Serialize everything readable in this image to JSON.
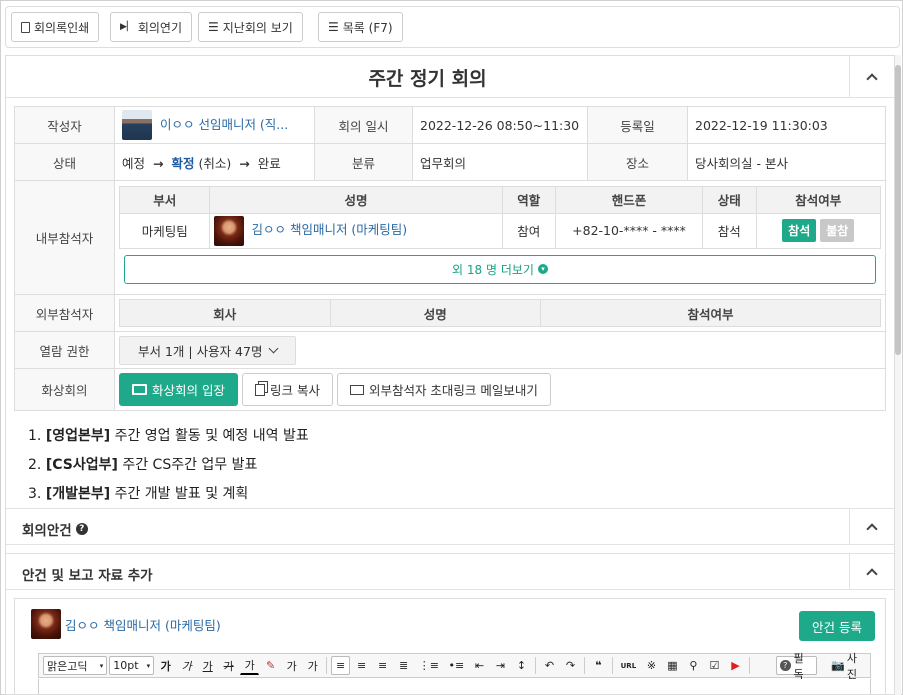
{
  "toolbar": {
    "print": "회의록인쇄",
    "postpone": "회의연기",
    "past_meetings": "지난회의 보기",
    "list": "목록 (F7)"
  },
  "meeting": {
    "title": "주간 정기 회의",
    "author_label": "작성자",
    "author_name": "이ㅇㅇ 선임매니저 (직...",
    "date_label": "회의 일시",
    "date_value": "2022-12-26 08:50~11:30",
    "reg_label": "등록일",
    "reg_value": "2022-12-19 11:30:03",
    "status_label": "상태",
    "status_1": "예정",
    "status_2": "확정",
    "status_2_note": "(취소)",
    "status_3": "완료",
    "status_arrow": "→",
    "category_label": "분류",
    "category_value": "업무회의",
    "place_label": "장소",
    "place_value": "당사회의실 - 본사",
    "internal_label": "내부참석자",
    "external_label": "외부참석자",
    "access_label": "열람 권한",
    "access_value": "부서 1개 | 사용자 47명",
    "video_label": "화상회의"
  },
  "internal": {
    "headers": [
      "부서",
      "성명",
      "역할",
      "핸드폰",
      "상태",
      "참석여부"
    ],
    "row": {
      "dept": "마케팅팀",
      "name": "김ㅇㅇ 책임매니저 (마케팅팀)",
      "role": "참여",
      "phone": "+82-10-**** - ****",
      "status": "참석",
      "attend": "참석",
      "absent": "불참"
    },
    "more": "외 18 명 더보기"
  },
  "external": {
    "headers": [
      "회사",
      "성명",
      "참석여부"
    ]
  },
  "video": {
    "enter": "화상회의 입장",
    "copy": "링크 복사",
    "mail": "외부참석자 초대링크 메일보내기"
  },
  "agenda": [
    {
      "num": "1.",
      "tag": "[영업본부]",
      "text": "주간 영업 활동 및 예정 내역 발표"
    },
    {
      "num": "2.",
      "tag": "[CS사업부]",
      "text": "주간 CS주간 업무 발표"
    },
    {
      "num": "3.",
      "tag": "[개발본부]",
      "text": "주간 개발 발표 및 계획"
    }
  ],
  "sections": {
    "agenda_title": "회의안건",
    "add_title": "안건 및 보고 자료 추가"
  },
  "editor": {
    "user": "김ㅇㅇ 책임매니저 (마케팅팀)",
    "register": "안건 등록",
    "font": "맑은고딕",
    "size": "10pt",
    "bold": "가",
    "italic": "가",
    "underline": "가",
    "strike": "가",
    "fontcolor": "가",
    "sup": "가",
    "sub": "가",
    "url": "URL",
    "required": "필독",
    "photo": "사진"
  },
  "colors": {
    "accent": "#1eaa8a",
    "link": "#2a6aa5",
    "absent": "#c8c8c8"
  }
}
